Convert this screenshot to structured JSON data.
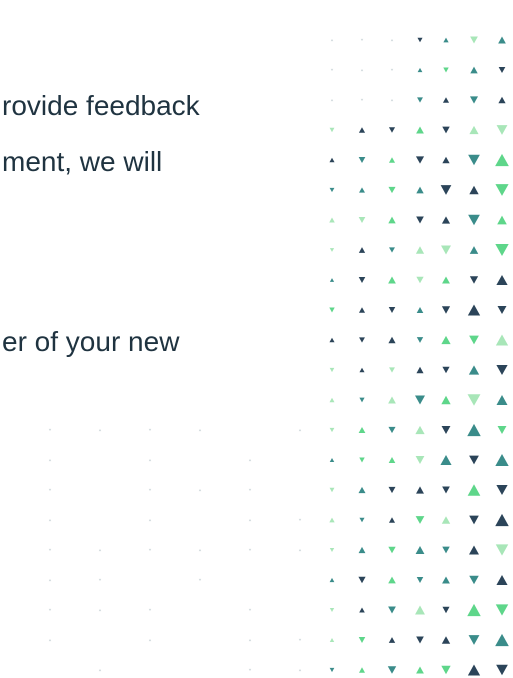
{
  "content": {
    "lines": [
      "rovide feedback",
      "ment, we will",
      "er of your new"
    ]
  },
  "decoration": {
    "name": "triangle-dot-pattern",
    "colors": {
      "text": "#1f3340",
      "navy": "#2b4459",
      "teal": "#3a8c8a",
      "green": "#5ed68a",
      "light_green": "#a8e6b8",
      "dot": "#cfd8dc"
    }
  }
}
